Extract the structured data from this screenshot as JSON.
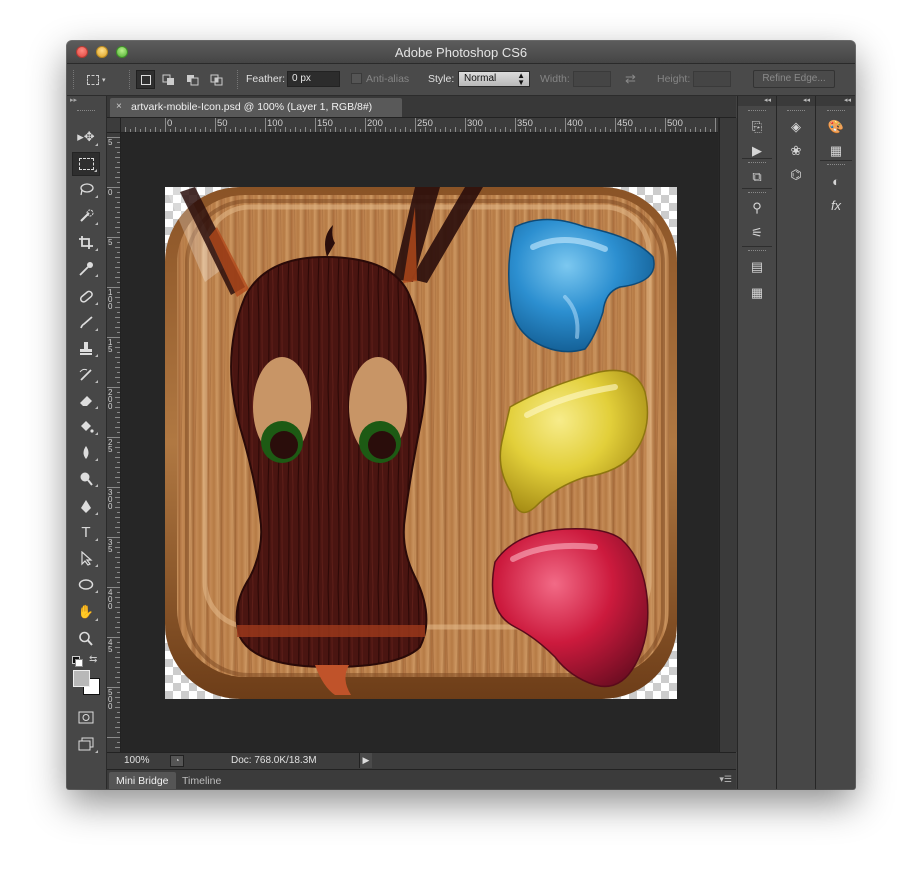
{
  "window": {
    "title": "Adobe Photoshop CS6"
  },
  "options_bar": {
    "feather_label": "Feather:",
    "feather_value": "0 px",
    "antialias_label": "Anti-alias",
    "style_label": "Style:",
    "style_value": "Normal",
    "width_label": "Width:",
    "height_label": "Height:",
    "refine_edge_label": "Refine Edge..."
  },
  "document": {
    "tab_title": "artvark-mobile-Icon.psd @ 100% (Layer 1, RGB/8#)",
    "tab_close": "×"
  },
  "ruler": {
    "top_labels": [
      "0",
      "50",
      "100",
      "150",
      "200",
      "250",
      "300",
      "350",
      "400",
      "450",
      "500"
    ],
    "left_labels": [
      "5",
      "0",
      "5",
      "1 0 0",
      "1 5",
      "2 0 0",
      "2 5",
      "3 0 0",
      "3 5",
      "4 0 0",
      "4 5",
      "5 0 0"
    ]
  },
  "status": {
    "zoom": "100%",
    "doc_info": "Doc: 768.0K/18.3M"
  },
  "bottom_tabs": [
    "Mini Bridge",
    "Timeline"
  ],
  "colors": {
    "foreground": "#b8b8b8",
    "background": "#ffffff",
    "ui_dark": "#424242"
  },
  "tools": [
    "move-icon",
    "marquee-icon",
    "lasso-icon",
    "quick-select-icon",
    "crop-icon",
    "eyedropper-icon",
    "healing-icon",
    "brush-icon",
    "stamp-icon",
    "history-brush-icon",
    "eraser-icon",
    "bucket-icon",
    "blur-icon",
    "dodge-icon",
    "pen-icon",
    "type-icon",
    "path-select-icon",
    "ellipse-icon",
    "hand-icon",
    "zoom-icon"
  ],
  "dock_icons": {
    "col1": [
      "history-icon",
      "actions-play-icon",
      "3d-icon",
      "brush-presets-icon",
      "adjust-icon",
      "notes-icon",
      "paragraph-icon"
    ],
    "col2": [
      "layers-icon",
      "channels-icon",
      "paths-icon"
    ],
    "col3": [
      "color-icon",
      "swatches-icon",
      "adjustments-icon",
      "styles-icon"
    ]
  }
}
